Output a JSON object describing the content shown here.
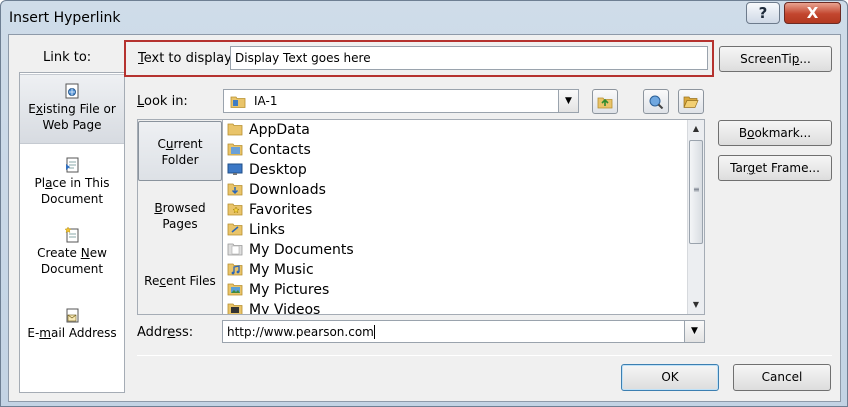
{
  "window": {
    "title": "Insert Hyperlink",
    "help_label": "?",
    "close_label": "X"
  },
  "link_to": {
    "label": "Link to:",
    "items": [
      {
        "pre": "E",
        "key": "x",
        "post": "isting File or Web Page",
        "line1_pre": "E",
        "line1_key": "x",
        "line1_post": "isting File or",
        "line2": "Web Page",
        "icon": "file-web-icon"
      },
      {
        "line1_pre": "Pl",
        "line1_key": "a",
        "line1_post": "ce in This",
        "line2": "Document",
        "icon": "place-in-doc-icon"
      },
      {
        "line1_pre": "Create ",
        "line1_key": "N",
        "line1_post": "ew",
        "line2": "Document",
        "icon": "new-document-icon"
      },
      {
        "line1_pre": "E-",
        "line1_key": "m",
        "line1_post": "ail Address",
        "line2": "",
        "icon": "email-icon"
      }
    ]
  },
  "text_to_display": {
    "label_key": "T",
    "label_post": "ext to display:",
    "value": "Display Text goes here"
  },
  "buttons": {
    "screentip_pre": "ScreenTi",
    "screentip_key": "p",
    "screentip_post": "...",
    "bookmark_pre": "B",
    "bookmark_key": "o",
    "bookmark_post": "okmark...",
    "target_pre": "Tar",
    "target_key": "g",
    "target_post": "et Frame...",
    "ok": "OK",
    "cancel": "Cancel"
  },
  "look_in": {
    "label_key": "L",
    "label_post": "ook in:",
    "value": "IA-1"
  },
  "folder_tabs": [
    {
      "line1_pre": "C",
      "line1_key": "u",
      "line1_post": "rrent",
      "line2": "Folder"
    },
    {
      "line1_pre": "",
      "line1_key": "B",
      "line1_post": "rowsed",
      "line2": "Pages"
    },
    {
      "line1_pre": "Re",
      "line1_key": "c",
      "line1_post": "ent Files",
      "line2": ""
    }
  ],
  "files": [
    {
      "name": "AppData",
      "icon": "folder-icon"
    },
    {
      "name": "Contacts",
      "icon": "contacts-folder-icon"
    },
    {
      "name": "Desktop",
      "icon": "desktop-folder-icon"
    },
    {
      "name": "Downloads",
      "icon": "downloads-folder-icon"
    },
    {
      "name": "Favorites",
      "icon": "favorites-folder-icon"
    },
    {
      "name": "Links",
      "icon": "links-folder-icon"
    },
    {
      "name": "My Documents",
      "icon": "documents-folder-icon"
    },
    {
      "name": "My Music",
      "icon": "music-folder-icon"
    },
    {
      "name": "My Pictures",
      "icon": "pictures-folder-icon"
    },
    {
      "name": "My Videos",
      "icon": "videos-folder-icon"
    }
  ],
  "address": {
    "label_pre": "Addr",
    "label_key": "e",
    "label_post": "ss:",
    "value": "http://www.pearson.com"
  }
}
